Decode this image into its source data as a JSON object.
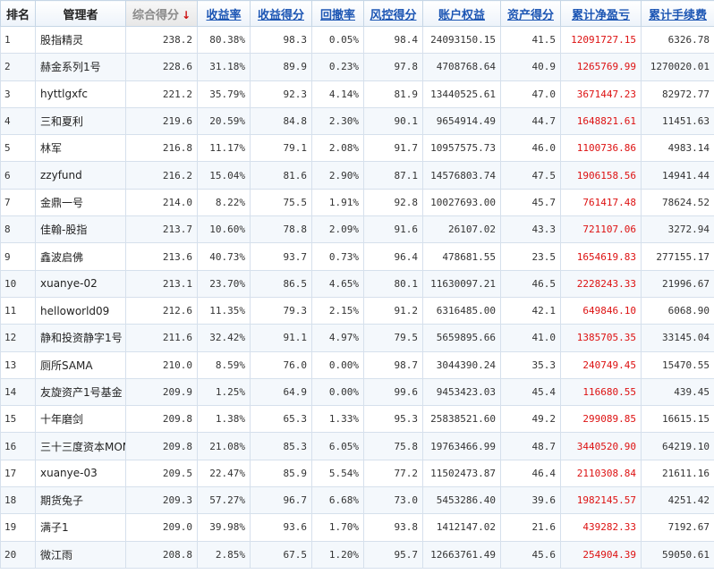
{
  "headers": {
    "rank": "排名",
    "manager": "管理者",
    "composite_score": "综合得分",
    "return_rate": "收益率",
    "return_score": "收益得分",
    "drawdown": "回撤率",
    "risk_score": "风控得分",
    "equity": "账户权益",
    "asset_score": "资产得分",
    "cum_net_pl": "累计净盈亏",
    "cum_fee": "累计手续费"
  },
  "sort_arrow": "↓",
  "colors": {
    "header_link": "#1d56b4",
    "profit_red": "#dd1111",
    "sort_arrow": "#cc1111"
  },
  "rows": [
    {
      "rank": "1",
      "manager": "股指精灵",
      "score": "238.2",
      "ret": "80.38%",
      "ret_score": "98.3",
      "dd": "0.05%",
      "risk": "98.4",
      "equity": "24093150.15",
      "asset": "41.5",
      "pl": "12091727.15",
      "fee": "6326.78"
    },
    {
      "rank": "2",
      "manager": "赫金系列1号",
      "score": "228.6",
      "ret": "31.18%",
      "ret_score": "89.9",
      "dd": "0.23%",
      "risk": "97.8",
      "equity": "4708768.64",
      "asset": "40.9",
      "pl": "1265769.99",
      "fee": "1270020.01"
    },
    {
      "rank": "3",
      "manager": "hyttlgxfc",
      "score": "221.2",
      "ret": "35.79%",
      "ret_score": "92.3",
      "dd": "4.14%",
      "risk": "81.9",
      "equity": "13440525.61",
      "asset": "47.0",
      "pl": "3671447.23",
      "fee": "82972.77"
    },
    {
      "rank": "4",
      "manager": "三和夏利",
      "score": "219.6",
      "ret": "20.59%",
      "ret_score": "84.8",
      "dd": "2.30%",
      "risk": "90.1",
      "equity": "9654914.49",
      "asset": "44.7",
      "pl": "1648821.61",
      "fee": "11451.63"
    },
    {
      "rank": "5",
      "manager": "林军",
      "score": "216.8",
      "ret": "11.17%",
      "ret_score": "79.1",
      "dd": "2.08%",
      "risk": "91.7",
      "equity": "10957575.73",
      "asset": "46.0",
      "pl": "1100736.86",
      "fee": "4983.14"
    },
    {
      "rank": "6",
      "manager": "zzyfund",
      "score": "216.2",
      "ret": "15.04%",
      "ret_score": "81.6",
      "dd": "2.90%",
      "risk": "87.1",
      "equity": "14576803.74",
      "asset": "47.5",
      "pl": "1906158.56",
      "fee": "14941.44"
    },
    {
      "rank": "7",
      "manager": "金鼎一号",
      "score": "214.0",
      "ret": "8.22%",
      "ret_score": "75.5",
      "dd": "1.91%",
      "risk": "92.8",
      "equity": "10027693.00",
      "asset": "45.7",
      "pl": "761417.48",
      "fee": "78624.52"
    },
    {
      "rank": "8",
      "manager": "佳翰-股指",
      "score": "213.7",
      "ret": "10.60%",
      "ret_score": "78.8",
      "dd": "2.09%",
      "risk": "91.6",
      "equity": "26107.02",
      "asset": "43.3",
      "pl": "721107.06",
      "fee": "3272.94"
    },
    {
      "rank": "9",
      "manager": "鑫波启佛",
      "score": "213.6",
      "ret": "40.73%",
      "ret_score": "93.7",
      "dd": "0.73%",
      "risk": "96.4",
      "equity": "478681.55",
      "asset": "23.5",
      "pl": "1654619.83",
      "fee": "277155.17"
    },
    {
      "rank": "10",
      "manager": "xuanye-02",
      "score": "213.1",
      "ret": "23.70%",
      "ret_score": "86.5",
      "dd": "4.65%",
      "risk": "80.1",
      "equity": "11630097.21",
      "asset": "46.5",
      "pl": "2228243.33",
      "fee": "21996.67"
    },
    {
      "rank": "11",
      "manager": "helloworld09",
      "score": "212.6",
      "ret": "11.35%",
      "ret_score": "79.3",
      "dd": "2.15%",
      "risk": "91.2",
      "equity": "6316485.00",
      "asset": "42.1",
      "pl": "649846.10",
      "fee": "6068.90"
    },
    {
      "rank": "12",
      "manager": "静和投资静字1号",
      "score": "211.6",
      "ret": "32.42%",
      "ret_score": "91.1",
      "dd": "4.97%",
      "risk": "79.5",
      "equity": "5659895.66",
      "asset": "41.0",
      "pl": "1385705.35",
      "fee": "33145.04"
    },
    {
      "rank": "13",
      "manager": "厕所SAMA",
      "score": "210.0",
      "ret": "8.59%",
      "ret_score": "76.0",
      "dd": "0.00%",
      "risk": "98.7",
      "equity": "3044390.24",
      "asset": "35.3",
      "pl": "240749.45",
      "fee": "15470.55"
    },
    {
      "rank": "14",
      "manager": "友旋资产1号基金",
      "score": "209.9",
      "ret": "1.25%",
      "ret_score": "64.9",
      "dd": "0.00%",
      "risk": "99.6",
      "equity": "9453423.03",
      "asset": "45.4",
      "pl": "116680.55",
      "fee": "439.45"
    },
    {
      "rank": "15",
      "manager": "十年磨剑",
      "score": "209.8",
      "ret": "1.38%",
      "ret_score": "65.3",
      "dd": "1.33%",
      "risk": "95.3",
      "equity": "25838521.60",
      "asset": "49.2",
      "pl": "299089.85",
      "fee": "16615.15"
    },
    {
      "rank": "16",
      "manager": "三十三度资本MOM",
      "score": "209.8",
      "ret": "21.08%",
      "ret_score": "85.3",
      "dd": "6.05%",
      "risk": "75.8",
      "equity": "19763466.99",
      "asset": "48.7",
      "pl": "3440520.90",
      "fee": "64219.10"
    },
    {
      "rank": "17",
      "manager": "xuanye-03",
      "score": "209.5",
      "ret": "22.47%",
      "ret_score": "85.9",
      "dd": "5.54%",
      "risk": "77.2",
      "equity": "11502473.87",
      "asset": "46.4",
      "pl": "2110308.84",
      "fee": "21611.16"
    },
    {
      "rank": "18",
      "manager": "期货兔子",
      "score": "209.3",
      "ret": "57.27%",
      "ret_score": "96.7",
      "dd": "6.68%",
      "risk": "73.0",
      "equity": "5453286.40",
      "asset": "39.6",
      "pl": "1982145.57",
      "fee": "4251.42"
    },
    {
      "rank": "19",
      "manager": "满子1",
      "score": "209.0",
      "ret": "39.98%",
      "ret_score": "93.6",
      "dd": "1.70%",
      "risk": "93.8",
      "equity": "1412147.02",
      "asset": "21.6",
      "pl": "439282.33",
      "fee": "7192.67"
    },
    {
      "rank": "20",
      "manager": "微江雨",
      "score": "208.8",
      "ret": "2.85%",
      "ret_score": "67.5",
      "dd": "1.20%",
      "risk": "95.7",
      "equity": "12663761.49",
      "asset": "45.6",
      "pl": "254904.39",
      "fee": "59050.61"
    }
  ]
}
